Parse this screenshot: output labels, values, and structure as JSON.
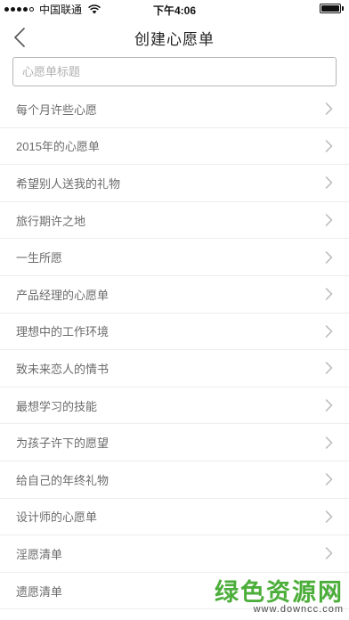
{
  "status_bar": {
    "carrier": "中国联通",
    "time": "下午4:06",
    "signal_bars_filled": 4,
    "signal_bars_total": 5,
    "battery_level": 1.0
  },
  "nav": {
    "title": "创建心愿单",
    "back_icon": "chevron-left-icon"
  },
  "title_input": {
    "placeholder": "心愿单标题",
    "value": ""
  },
  "list": {
    "items": [
      {
        "label": "每个月许些心愿"
      },
      {
        "label": "2015年的心愿单"
      },
      {
        "label": "希望别人送我的礼物"
      },
      {
        "label": "旅行期许之地"
      },
      {
        "label": "一生所愿"
      },
      {
        "label": "产品经理的心愿单"
      },
      {
        "label": "理想中的工作环境"
      },
      {
        "label": "致未来恋人的情书"
      },
      {
        "label": "最想学习的技能"
      },
      {
        "label": "为孩子许下的愿望"
      },
      {
        "label": "给自己的年终礼物"
      },
      {
        "label": "设计师的心愿单"
      },
      {
        "label": "淫愿清单"
      },
      {
        "label": "遗愿清单"
      }
    ]
  },
  "watermark": {
    "main": "绿色资源网",
    "sub": "www.downcc.com"
  },
  "colors": {
    "accent_green": "#4cae3a",
    "item_text": "#6b6b6b",
    "divider": "#ececec"
  }
}
